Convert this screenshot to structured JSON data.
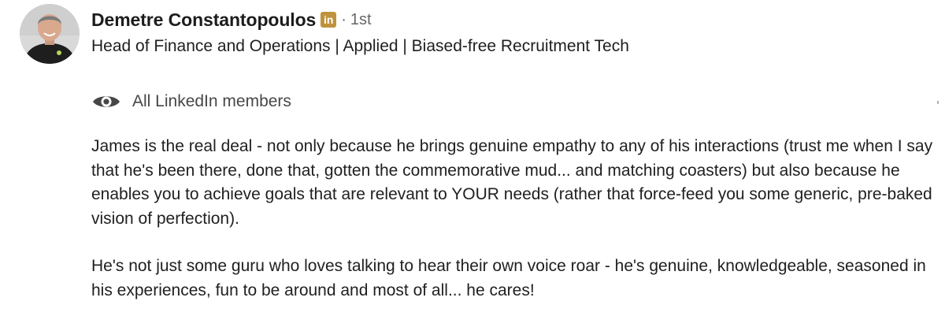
{
  "recommendation": {
    "author": {
      "name": "Demetre Constantopoulos",
      "badge_icon": "linkedin-icon",
      "badge_text": "in",
      "separator": "·",
      "degree": "1st",
      "headline": "Head of Finance and Operations | Applied | Biased-free Recruitment Tech"
    },
    "visibility": {
      "icon": "eye-icon",
      "label": "All LinkedIn members"
    },
    "paragraphs": [
      "James is the real deal - not only because he brings genuine empathy to any of his interactions (trust me when I say that he's been there, done that, gotten the commemorative mud... and matching coasters) but also because he enables you to achieve goals that are relevant to YOUR needs (rather that force-feed you some generic, pre-baked vision of perfection).",
      "He's not just some guru who loves talking to hear their own voice roar - he's genuine, knowledgeable, seasoned in his experiences, fun to be around and most of all... he cares!"
    ]
  },
  "colors": {
    "badge": "#c0923b",
    "text": "#1f1f1f",
    "muted": "#666666"
  }
}
